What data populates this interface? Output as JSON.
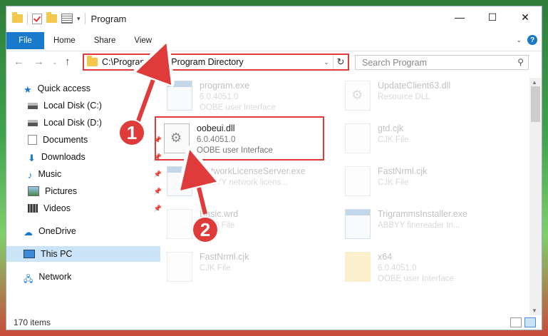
{
  "window": {
    "title": "Program",
    "controls": {
      "minimize": "—",
      "maximize": "☐",
      "close": "✕"
    }
  },
  "ribbon": {
    "tabs": [
      {
        "label": "File"
      },
      {
        "label": "Home"
      },
      {
        "label": "Share"
      },
      {
        "label": "View"
      }
    ],
    "help": "?"
  },
  "nav": {
    "address": "C:\\Program Files\\Program Directory",
    "search_placeholder": "Search Program"
  },
  "sidebar": {
    "items": [
      {
        "label": "Quick access",
        "icon": "star-icon"
      },
      {
        "label": "Local Disk (C:)",
        "icon": "drive-icon"
      },
      {
        "label": "Local Disk (D:)",
        "icon": "drive-icon"
      },
      {
        "label": "Documents",
        "icon": "documents-icon"
      },
      {
        "label": "Downloads",
        "icon": "downloads-icon"
      },
      {
        "label": "Music",
        "icon": "music-icon"
      },
      {
        "label": "Pictures",
        "icon": "pictures-icon"
      },
      {
        "label": "Videos",
        "icon": "videos-icon"
      },
      {
        "label": "OneDrive",
        "icon": "cloud-icon"
      },
      {
        "label": "This PC",
        "icon": "computer-icon"
      },
      {
        "label": "Network",
        "icon": "network-icon"
      }
    ]
  },
  "files": [
    {
      "name": "program.exe",
      "sub1": "6.0.4051.0",
      "sub2": "OOBE user Interface",
      "type": "exe"
    },
    {
      "name": "UpdateClient63.dll",
      "sub1": "Resource DLL",
      "sub2": "",
      "type": "dll"
    },
    {
      "name": "oobeui.dll",
      "sub1": "6.0.4051.0",
      "sub2": "OOBE user Interface",
      "type": "dll"
    },
    {
      "name": "gtd.cjk",
      "sub1": "CJK File",
      "sub2": "",
      "type": "doc"
    },
    {
      "name": "NetworkLicenseServer.exe",
      "sub1": "ABBYY network licens...",
      "sub2": "",
      "type": "exe"
    },
    {
      "name": "FastNrml.cjk",
      "sub1": "CJK File",
      "sub2": "",
      "type": "doc"
    },
    {
      "name": "Basic.wrd",
      "sub1": "WRD File",
      "sub2": "",
      "type": "doc"
    },
    {
      "name": "TrigrammsInstaller.exe",
      "sub1": "ABBYY finereader tri...",
      "sub2": "",
      "type": "exe"
    },
    {
      "name": "FastNrml.cjk",
      "sub1": "CJK File",
      "sub2": "",
      "type": "doc"
    },
    {
      "name": "x64",
      "sub1": "6.0.4051.0",
      "sub2": "OOBE user Interface",
      "type": "folder"
    }
  ],
  "status": {
    "count": "170 items"
  },
  "callouts": {
    "one": "1",
    "two": "2"
  },
  "colors": {
    "accent": "#1979ca",
    "highlight": "#e23a3a",
    "selected": "#cce4f7"
  }
}
